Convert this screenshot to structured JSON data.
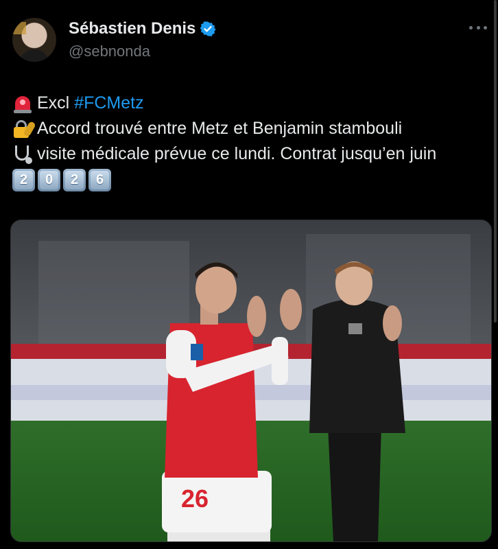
{
  "author": {
    "name": "Sébastien Denis",
    "handle": "@sebnonda",
    "verified": true,
    "avatar_icon": "profile-photo"
  },
  "tweet": {
    "line1_emoji": "rotating-light-icon",
    "line1_text": "Excl ",
    "line1_hashtag": "#FCMetz",
    "line2_emoji": "locked-with-key-icon",
    "line2_text": "Accord trouvé entre Metz et Benjamin stambouli",
    "line3_emoji": "stethoscope-icon",
    "line3_text": "visite médicale prévue ce lundi. Contrat jusqu’en juin",
    "year_digits": [
      "2",
      "0",
      "2",
      "6"
    ]
  },
  "media": {
    "jersey_number": "26"
  },
  "colors": {
    "background": "#000000",
    "text": "#e7e9ea",
    "muted": "#71767b",
    "link": "#1d9bf0",
    "verified": "#1d9bf0"
  }
}
